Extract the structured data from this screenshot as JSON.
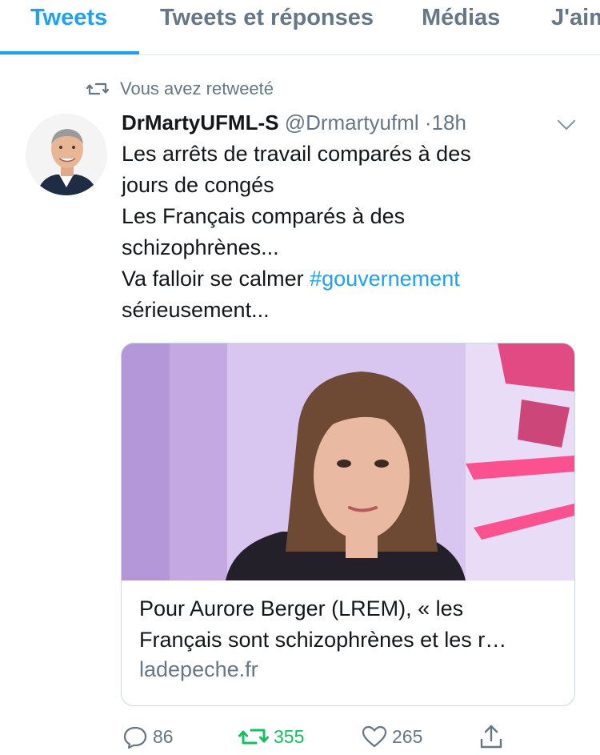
{
  "tabs": [
    {
      "label": "Tweets",
      "active": true
    },
    {
      "label": "Tweets et réponses",
      "active": false
    },
    {
      "label": "Médias",
      "active": false
    },
    {
      "label": "J'aime",
      "active": false
    }
  ],
  "retweet_context": {
    "icon": "retweet-icon",
    "text": "Vous avez retweeté"
  },
  "tweet": {
    "author_name": "DrMartyUFML-S",
    "author_handle": "@Drmartyufml",
    "separator": "·",
    "time": "18h",
    "text_lines": [
      "Les arrêts de travail comparés à des",
      "jours de congés",
      "Les Français comparés à des",
      "schizophrènes...",
      "Va falloir se calmer ",
      "sérieusement..."
    ],
    "hashtag": "#gouvernement",
    "card": {
      "title_line1": "Pour Aurore Berger (LREM), « les",
      "title_line2": "Français sont schizophrènes et les r…",
      "domain": "ladepeche.fr"
    },
    "actions": {
      "reply_count": "86",
      "retweet_count": "355",
      "like_count": "265"
    }
  },
  "colors": {
    "accent": "#1da1f2",
    "secondary_text": "#657786",
    "retweet_green": "#17bf63"
  }
}
